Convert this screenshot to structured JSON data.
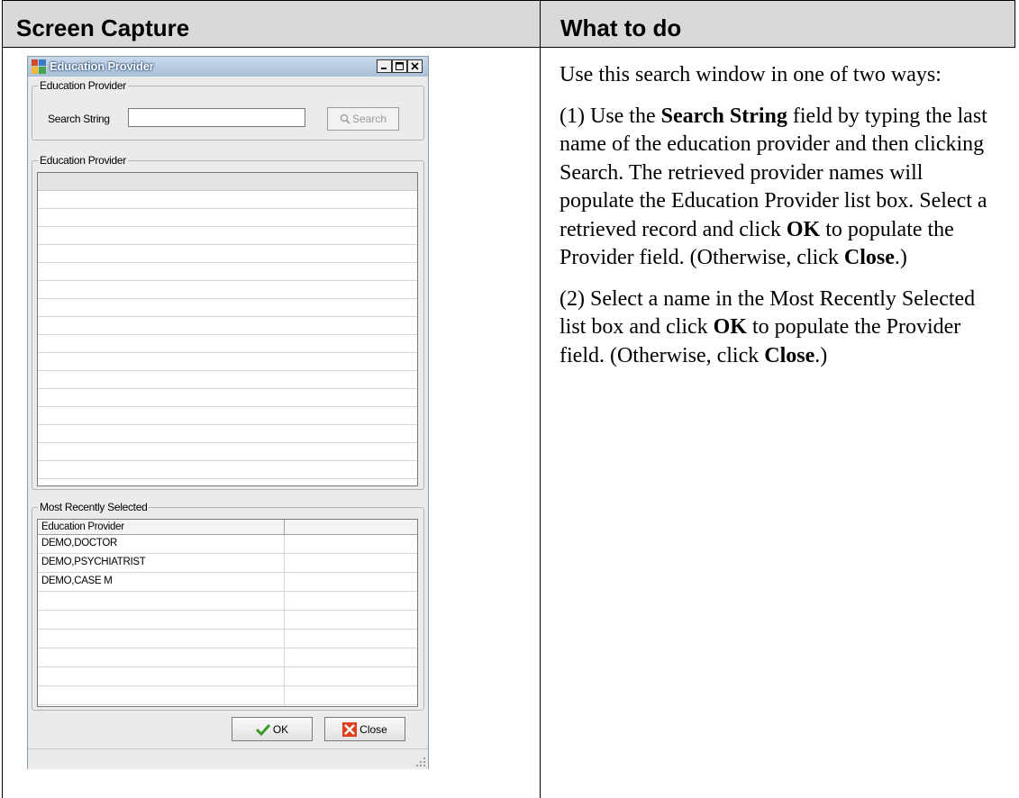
{
  "table": {
    "header_left": "Screen Capture",
    "header_right": "What to do"
  },
  "instructions": {
    "p1": "Use this search window in one of two ways:",
    "p2_a": "(1) Use the ",
    "p2_b": "Search String",
    "p2_c": " field by typing the last name of the education provider and then clicking Search. The retrieved provider names will populate the Education Provider list box. Select a retrieved record and click ",
    "p2_d": "OK",
    "p2_e": " to populate the Provider field. (Otherwise, click ",
    "p2_f": "Close",
    "p2_g": ".)",
    "p3_a": "(2) Select a name in the Most Recently Selected list box and click ",
    "p3_b": "OK",
    "p3_c": " to populate the Provider field. (Otherwise, click ",
    "p3_d": "Close",
    "p3_e": ".)"
  },
  "window": {
    "title": "Education Provider",
    "search_group_label": "Education Provider",
    "search_label": "Search String",
    "search_value": "",
    "search_button": "Search",
    "results_group_label": "Education Provider",
    "recent_group_label": "Most Recently Selected",
    "recent_column_header": "Education Provider",
    "recent_rows": [
      "DEMO,DOCTOR",
      "DEMO,PSYCHIATRIST",
      "DEMO,CASE M"
    ],
    "ok_button": "OK",
    "close_button": "Close",
    "icons": [
      "app-icon",
      "minimize-icon",
      "maximize-icon",
      "close-icon",
      "magnifier-icon",
      "checkmark-icon",
      "red-x-icon",
      "resize-grip-icon"
    ]
  }
}
